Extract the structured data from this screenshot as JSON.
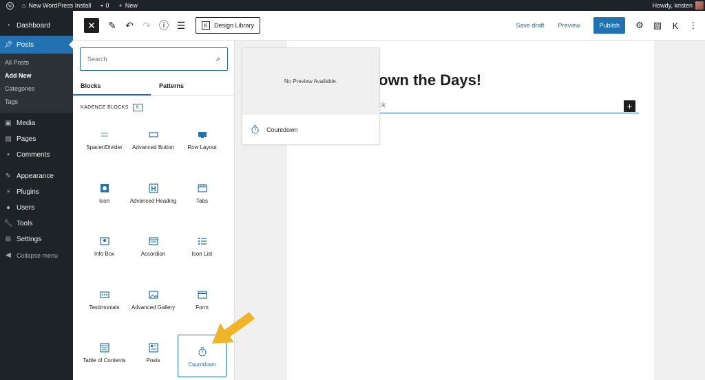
{
  "admin_bar": {
    "site_name": "New WordPress Install",
    "comments_count": "0",
    "new_label": "New",
    "greeting": "Howdy, kristen"
  },
  "admin_menu": {
    "items": [
      {
        "label": "Dashboard",
        "icon": "dashboard-icon"
      },
      {
        "label": "Posts",
        "icon": "pin-icon"
      },
      {
        "label": "Media",
        "icon": "media-icon"
      },
      {
        "label": "Pages",
        "icon": "pages-icon"
      },
      {
        "label": "Comments",
        "icon": "comments-icon"
      },
      {
        "label": "Appearance",
        "icon": "appearance-icon"
      },
      {
        "label": "Plugins",
        "icon": "plugins-icon"
      },
      {
        "label": "Users",
        "icon": "users-icon"
      },
      {
        "label": "Tools",
        "icon": "tools-icon"
      },
      {
        "label": "Settings",
        "icon": "settings-icon"
      }
    ],
    "posts_submenu": [
      "All Posts",
      "Add New",
      "Categories",
      "Tags"
    ],
    "collapse_label": "Collapse menu"
  },
  "editor_header": {
    "design_library_label": "Design Library",
    "save_draft_label": "Save draft",
    "preview_label": "Preview",
    "publish_label": "Publish"
  },
  "inserter": {
    "search_placeholder": "Search",
    "tabs": [
      "Blocks",
      "Patterns"
    ],
    "category_title": "KADENCE BLOCKS",
    "blocks": [
      {
        "label": "Spacer/Divider",
        "icon": "spacer-icon"
      },
      {
        "label": "Advanced Button",
        "icon": "button-icon"
      },
      {
        "label": "Row Layout",
        "icon": "row-layout-icon"
      },
      {
        "label": "Icon",
        "icon": "icon-block-icon"
      },
      {
        "label": "Advanced Heading",
        "icon": "heading-icon"
      },
      {
        "label": "Tabs",
        "icon": "tabs-icon"
      },
      {
        "label": "Info Box",
        "icon": "info-box-icon"
      },
      {
        "label": "Accordion",
        "icon": "accordion-icon"
      },
      {
        "label": "Icon List",
        "icon": "icon-list-icon"
      },
      {
        "label": "Testimonials",
        "icon": "testimonials-icon"
      },
      {
        "label": "Advanced Gallery",
        "icon": "gallery-icon"
      },
      {
        "label": "Form",
        "icon": "form-icon"
      },
      {
        "label": "Table of Contents",
        "icon": "toc-icon"
      },
      {
        "label": "Posts",
        "icon": "posts-icon"
      },
      {
        "label": "Countdown",
        "icon": "countdown-icon"
      }
    ]
  },
  "canvas": {
    "title_visible": "own the Days!",
    "paragraph_visible": "ck"
  },
  "preview_popover": {
    "no_preview_text": "No Preview Available.",
    "block_name": "Countdown"
  },
  "colors": {
    "admin_dark": "#1d2327",
    "accent": "#2271b1",
    "arrow": "#f0b429"
  }
}
